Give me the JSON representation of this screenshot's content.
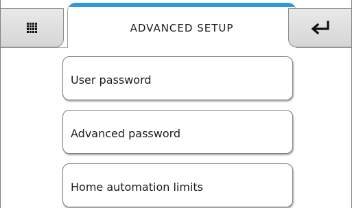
{
  "header": {
    "title": "ADVANCED SETUP",
    "menu_icon": "grid-menu-icon",
    "back_icon": "return-arrow-icon",
    "accent_color": "#2b9bd9"
  },
  "menu": {
    "items": [
      {
        "label": "User password"
      },
      {
        "label": "Advanced password"
      },
      {
        "label": "Home automation limits"
      }
    ]
  }
}
